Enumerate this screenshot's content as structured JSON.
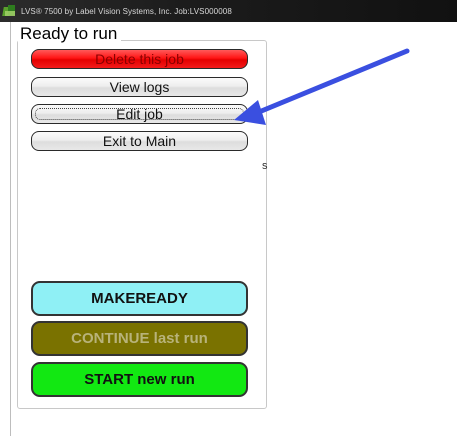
{
  "window": {
    "title": "LVS® 7500 by Label Vision Systems, Inc.  Job:LVS000008"
  },
  "panel": {
    "title": "Ready to run",
    "buttons": {
      "delete": "Delete this job",
      "view_logs": "View logs",
      "edit": "Edit job",
      "exit": "Exit to Main",
      "makeready": "MAKEREADY",
      "continue": "CONTINUE last run",
      "start": "START new run"
    }
  },
  "stray_text": "s",
  "annotation": {
    "type": "arrow",
    "color": "#3a4fe0"
  },
  "colors": {
    "delete": "#ff1515",
    "makeready": "#8ff0f5",
    "continue": "#7a7200",
    "start": "#12e812"
  }
}
